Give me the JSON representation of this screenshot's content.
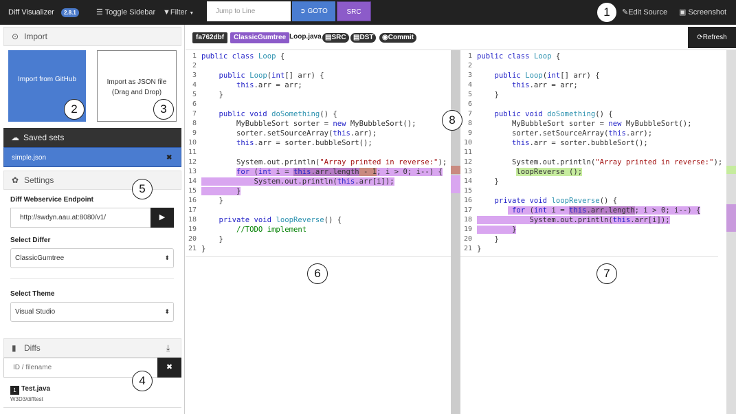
{
  "navbar": {
    "brand": "Diff Visualizer",
    "version": "2.8.1",
    "toggle_sidebar": "Toggle Sidebar",
    "filter": "Filter",
    "jump_placeholder": "Jump to Line",
    "goto": "GOTO",
    "src": "SRC",
    "edit_source": "Edit Source",
    "screenshot": "Screenshot"
  },
  "callouts": [
    "1",
    "2",
    "3",
    "4",
    "5",
    "6",
    "7",
    "8"
  ],
  "sidebar": {
    "import_title": "Import",
    "import_github": "Import from GitHub",
    "import_json_line1": "Import as JSON file",
    "import_json_line2": "(Drag and Drop)",
    "saved_sets_title": "Saved sets",
    "saved_item": "simple.json",
    "settings_title": "Settings",
    "endpoint_label": "Diff Webservice Endpoint",
    "endpoint_value": "http://swdyn.aau.at:8080/v1/",
    "differ_label": "Select Differ",
    "differ_value": "ClassicGumtree",
    "theme_label": "Select Theme",
    "theme_value": "Visual Studio",
    "diffs_title": "Diffs",
    "diffs_placeholder": "ID / filename",
    "diff_item": {
      "index": "1",
      "name": "Test.java",
      "path": "W3D3/difftest"
    }
  },
  "toolbar": {
    "commit_id": "fa762dbf",
    "differ": "ClassicGumtree",
    "file": "Loop.java",
    "src_btn": "SRC",
    "dst_btn": "DST",
    "commit_btn": "Commit",
    "refresh": "Refresh"
  },
  "colors": {
    "navbar": "#222222",
    "accent_blue": "#4a7cd0",
    "accent_purple": "#8c5bc9",
    "move_highlight": "#d9a6f0",
    "delete_highlight": "#c98a80",
    "insert_highlight": "#c6ec9e"
  }
}
